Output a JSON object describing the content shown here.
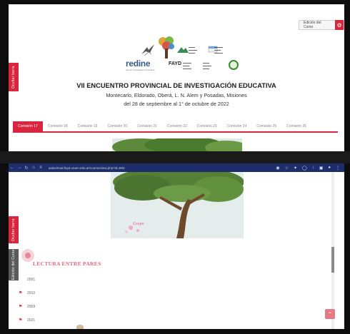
{
  "upper": {
    "side_tab_label": "Ocultar barra",
    "edit_button_label": "Edición del Curso",
    "logos": {
      "redine": "redine",
      "redine_sub": "red de investigación educativa",
      "fayd": "FAYD"
    },
    "title": "VII ENCUENTRO PROVINCIAL DE INVESTIGACIÓN EDUCATIVA",
    "subtitle_line1": "Montecarlo, Eldorado, Oberá, L. N. Alem y Posadas, Misiones",
    "subtitle_line2": "del 28 de septiembre al 1° de octubre de 2022",
    "tabs": [
      {
        "label": "Comisión 17",
        "active": true
      },
      {
        "label": "Comisión 18",
        "active": false
      },
      {
        "label": "Comisión 19",
        "active": false
      },
      {
        "label": "Comisión 20",
        "active": false
      },
      {
        "label": "Comisión 21",
        "active": false
      },
      {
        "label": "Comisión 22",
        "active": false
      },
      {
        "label": "Comisión 23",
        "active": false
      },
      {
        "label": "Comisión 24",
        "active": false
      },
      {
        "label": "Comisión 25",
        "active": false
      },
      {
        "label": "Comisión 26",
        "active": false
      }
    ]
  },
  "browser": {
    "url": "aulavirtual.fayd.unam.edu.ar/course/view.php?id=993"
  },
  "lower": {
    "side_tab_label": "Ocultar barra",
    "side_tab2_label": "Edición del Curso",
    "grupo_label": "Grupo",
    "section_title": "LECTURA ENTRE PARES",
    "years": [
      {
        "label": "2001",
        "flag": false
      },
      {
        "label": "2010",
        "flag": true
      },
      {
        "label": "2009",
        "flag": true
      },
      {
        "label": "2021",
        "flag": true
      }
    ]
  },
  "colors": {
    "accent": "#d7263d",
    "browser_bar": "#1e2d6b",
    "section_title": "#e0677f"
  }
}
